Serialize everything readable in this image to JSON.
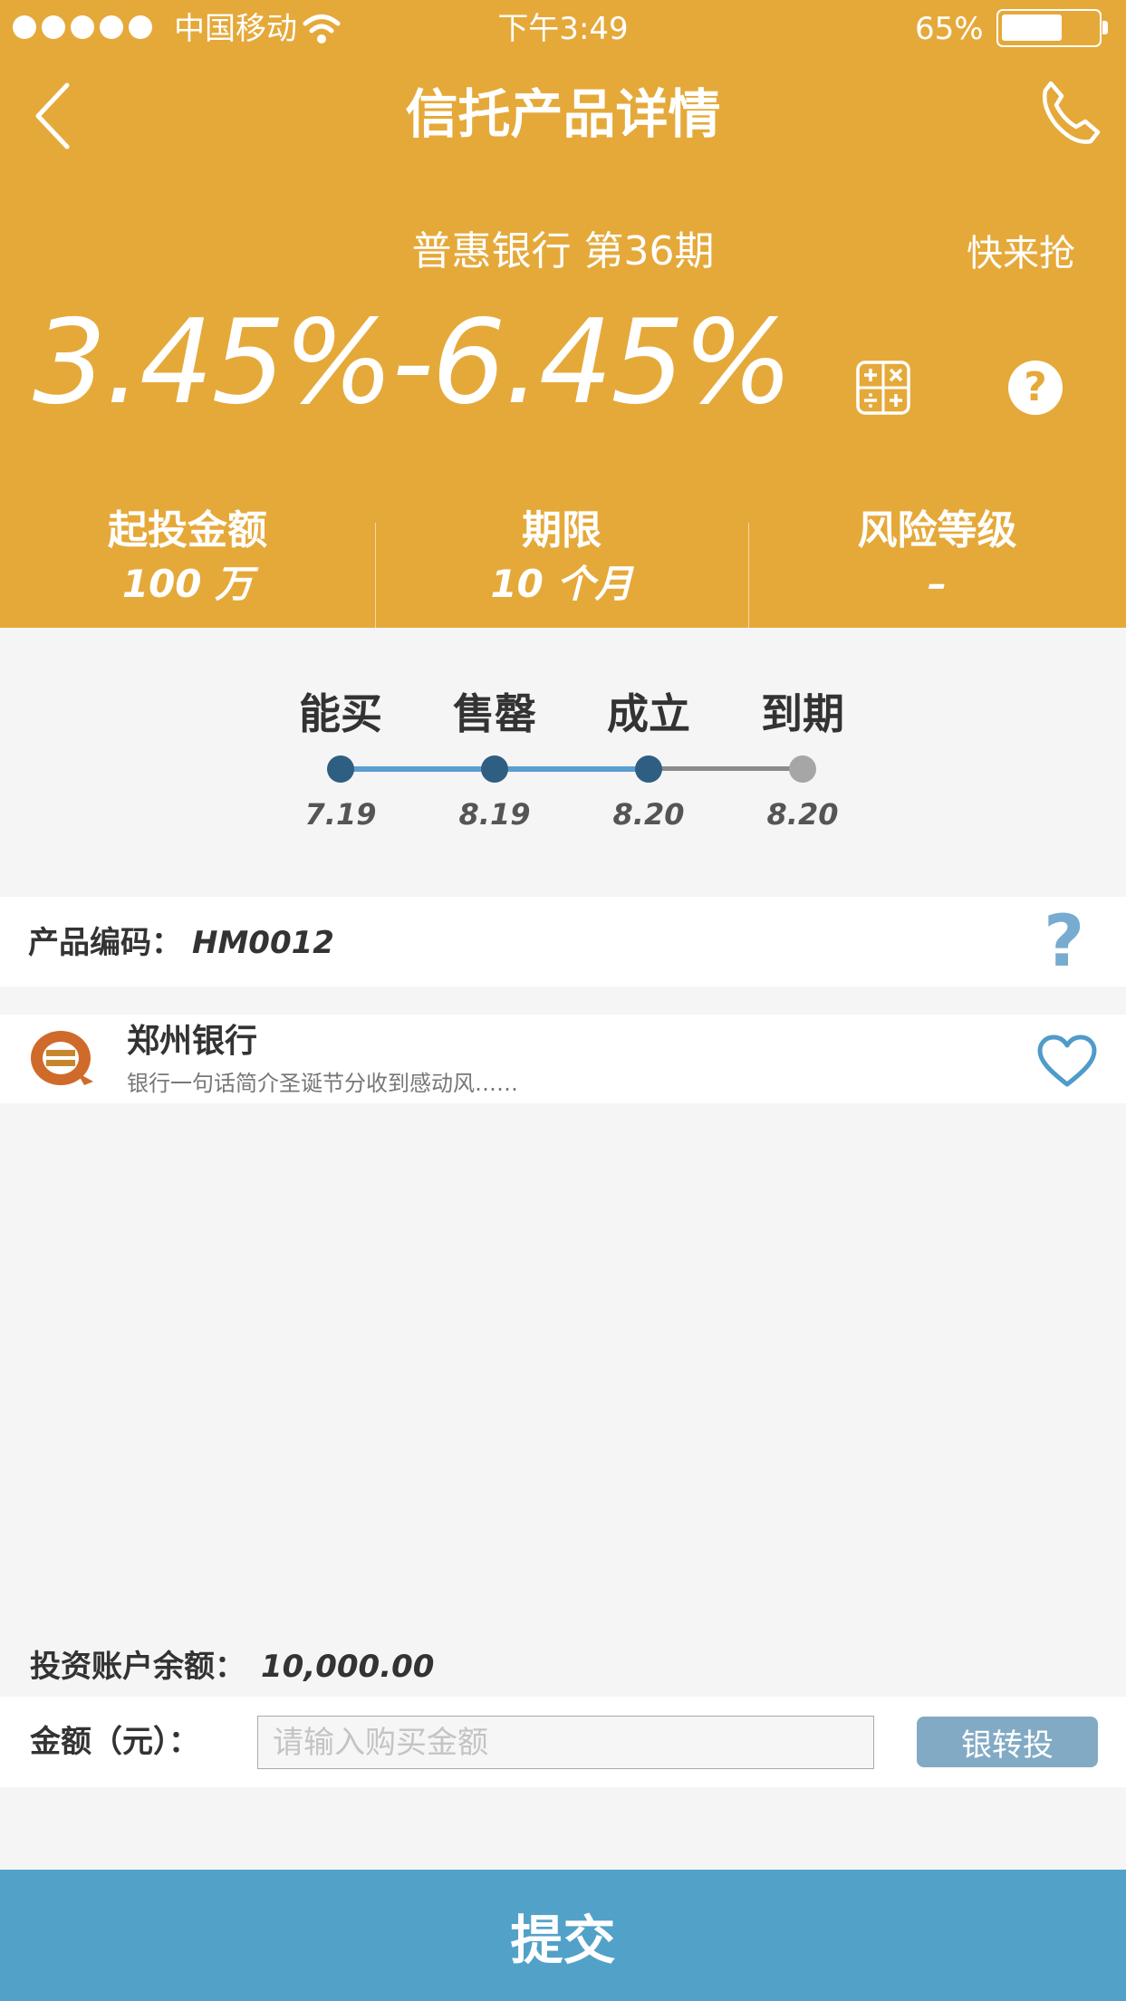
{
  "status_bar": {
    "carrier": "中国移动",
    "time": "下午3:49",
    "battery": "65%"
  },
  "nav": {
    "title": "信托产品详情",
    "back_icon": "chevron-left-icon",
    "phone_icon": "phone-icon"
  },
  "product": {
    "issuer_period": "普惠银行 第36期",
    "tag": "快来抢",
    "rate_range": "3.45%-6.45%",
    "stats": [
      {
        "label": "起投金额",
        "value": "100 万"
      },
      {
        "label": "期限",
        "value": "10 个月"
      },
      {
        "label": "风险等级",
        "value": "–"
      }
    ]
  },
  "timeline": {
    "stages": [
      {
        "label": "能买",
        "date": "7.19",
        "done": true
      },
      {
        "label": "售罄",
        "date": "8.19",
        "done": true
      },
      {
        "label": "成立",
        "date": "8.20",
        "done": true
      },
      {
        "label": "到期",
        "date": "8.20",
        "done": false
      }
    ]
  },
  "code": {
    "label": "产品编码：",
    "value": "HM0012",
    "help_glyph": "?"
  },
  "bank": {
    "name": "郑州银行",
    "description": "银行一句话简介圣诞节分收到感动风……"
  },
  "balance": {
    "label": "投资账户余额：",
    "value": "10,000.00"
  },
  "amount": {
    "label": "金额（元）：",
    "placeholder": "请输入购买金额",
    "value": "",
    "transfer_button": "银转投"
  },
  "submit": {
    "label": "提交"
  },
  "colors": {
    "accent": "#e5a93a",
    "primary": "#52a1c9",
    "node_done": "#2e5f82",
    "node_pending": "#a6a6a6",
    "track_done": "#5a9fd0",
    "transfer_btn": "#82aac4"
  }
}
